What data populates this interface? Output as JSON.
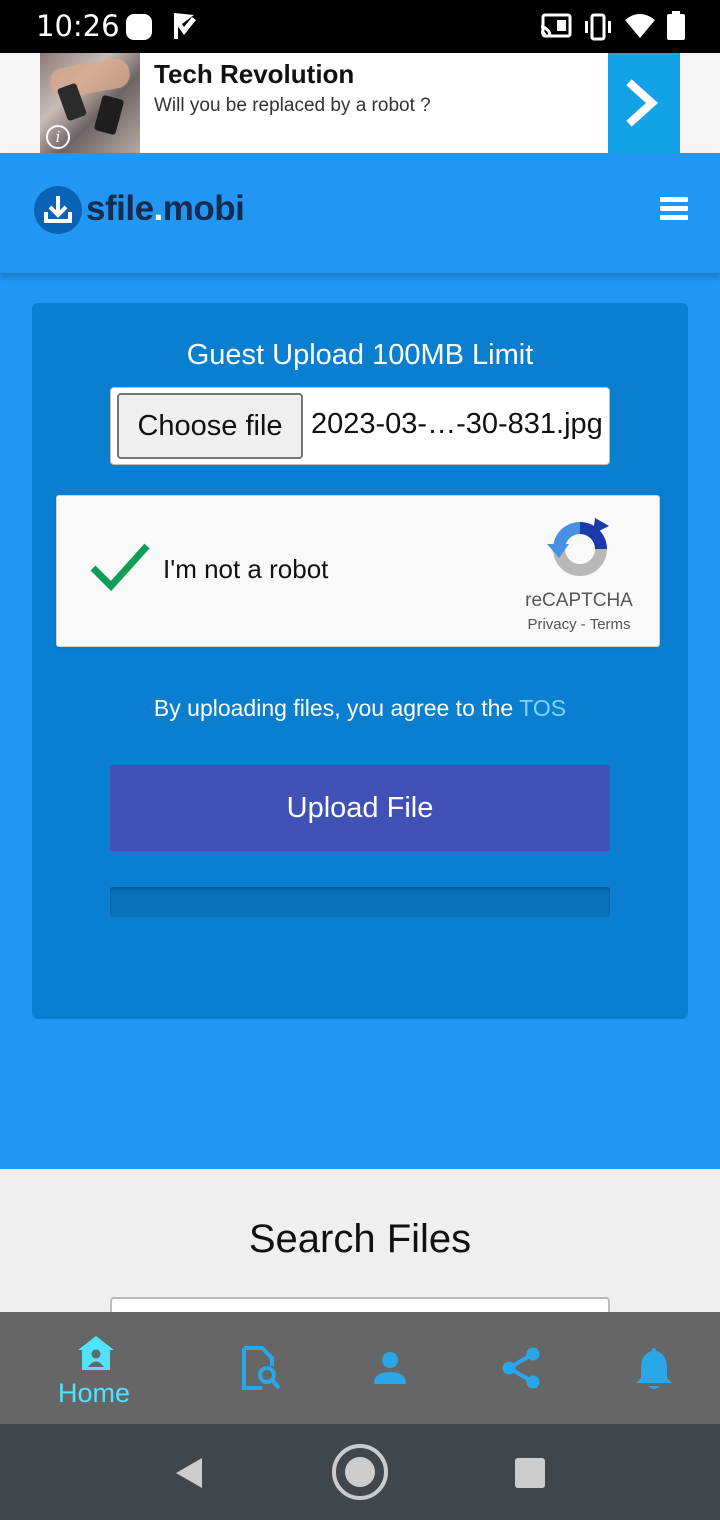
{
  "status_bar": {
    "time": "10:26"
  },
  "ad": {
    "title": "Tech Revolution",
    "subtitle": "Will you be replaced by a robot ?",
    "info_icon": "info-icon",
    "arrow_icon": "chevron-right-icon",
    "accent_color": "#14a2e6"
  },
  "header": {
    "logo_text_main": "sfile",
    "logo_text_dot": ".",
    "logo_text_tld": "mobi",
    "menu_icon": "hamburger-icon",
    "background": "#2196f3"
  },
  "upload": {
    "title": "Guest Upload 100MB Limit",
    "choose_file_label": "Choose file",
    "selected_file": "2023-03-…-30-831.jpg",
    "captcha": {
      "label": "I'm not a robot",
      "checked": true,
      "brand": "reCAPTCHA",
      "privacy": "Privacy",
      "separator": "-",
      "terms": "Terms"
    },
    "tos_text": "By uploading files, you agree to the ",
    "tos_link": "TOS",
    "upload_button": "Upload File",
    "progress_percent": 0
  },
  "search": {
    "title": "Search Files"
  },
  "bottom_nav": {
    "items": [
      {
        "label": "Home",
        "icon": "home-icon",
        "active": true
      },
      {
        "label": "",
        "icon": "search-file-icon",
        "active": false
      },
      {
        "label": "",
        "icon": "user-icon",
        "active": false
      },
      {
        "label": "",
        "icon": "share-icon",
        "active": false
      },
      {
        "label": "",
        "icon": "bell-icon",
        "active": false
      }
    ],
    "active_color": "#4fe3ff",
    "icon_color": "#2aa7e8"
  },
  "system_nav": {
    "icons": [
      "back-icon",
      "home-circle-icon",
      "recents-icon"
    ]
  }
}
